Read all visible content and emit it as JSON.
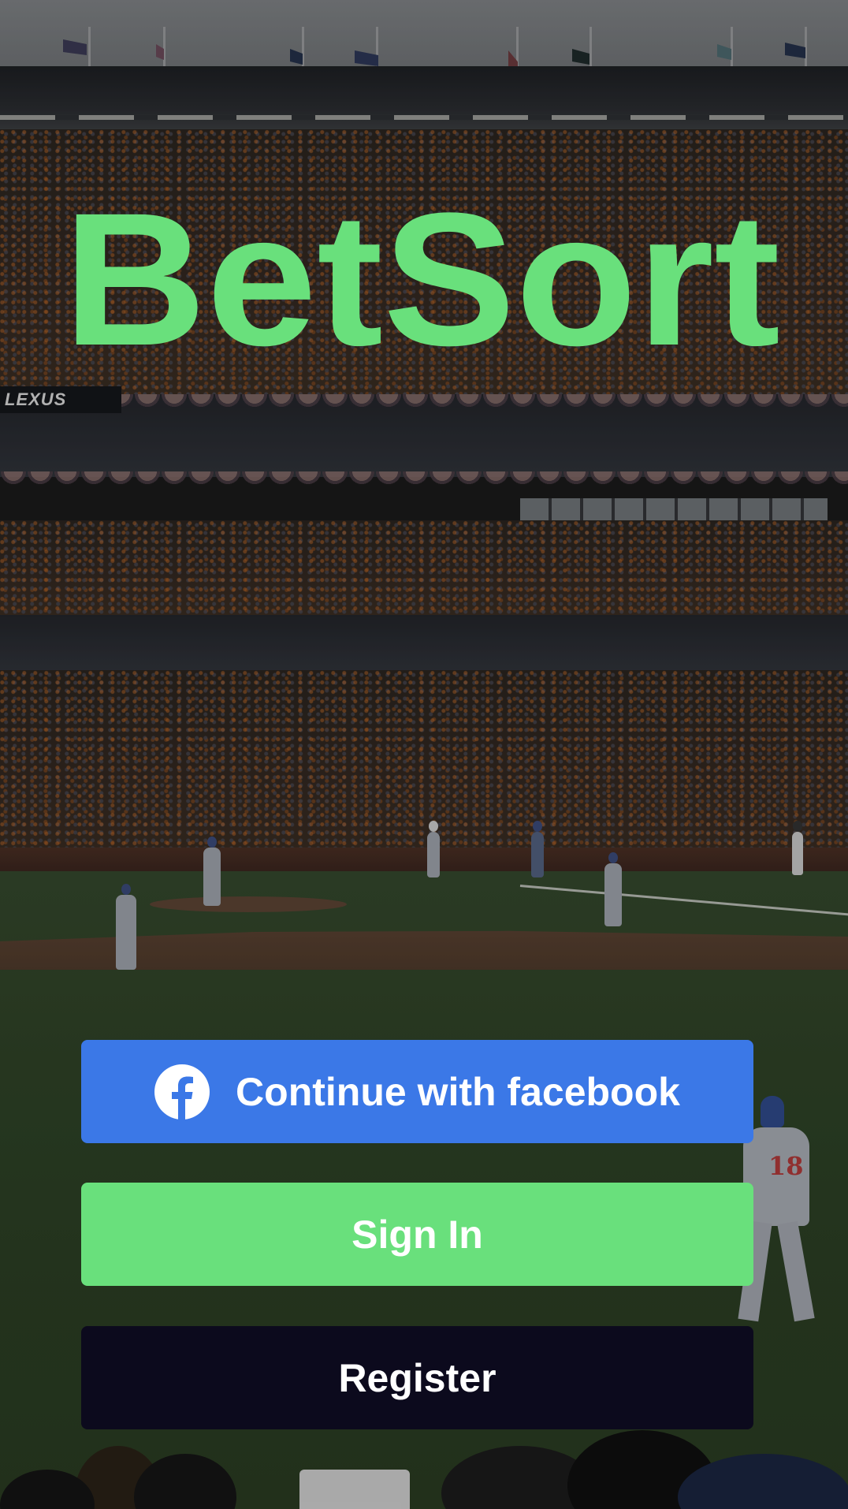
{
  "app": {
    "logo_text": "BetSort",
    "brand_color": "#69e07c"
  },
  "auth": {
    "facebook_label": "Continue with facebook",
    "facebook_icon": "facebook-icon",
    "facebook_color": "#3b78e7",
    "signin_label": "Sign In",
    "signin_color": "#69e07c",
    "register_label": "Register",
    "register_color": "#0c0a1d"
  },
  "background": {
    "description_icon": "baseball-stadium-photo",
    "sponsor_text": "LEXUS",
    "player_number": "18"
  }
}
